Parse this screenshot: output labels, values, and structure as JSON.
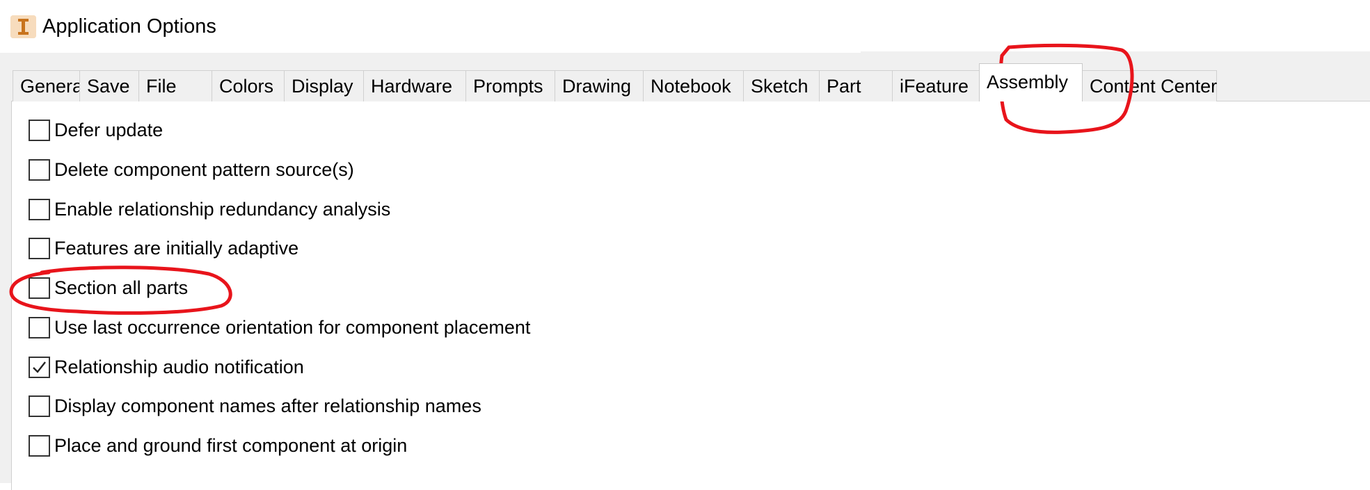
{
  "window": {
    "title": "Application Options",
    "icon": "autodesk-inventor-i-icon"
  },
  "tabs": [
    {
      "label": "General",
      "active": false
    },
    {
      "label": "Save",
      "active": false
    },
    {
      "label": "File",
      "active": false
    },
    {
      "label": "Colors",
      "active": false
    },
    {
      "label": "Display",
      "active": false
    },
    {
      "label": "Hardware",
      "active": false
    },
    {
      "label": "Prompts",
      "active": false
    },
    {
      "label": "Drawing",
      "active": false
    },
    {
      "label": "Notebook",
      "active": false
    },
    {
      "label": "Sketch",
      "active": false
    },
    {
      "label": "Part",
      "active": false
    },
    {
      "label": "iFeature",
      "active": false
    },
    {
      "label": "Assembly",
      "active": true
    },
    {
      "label": "Content Center",
      "active": false
    }
  ],
  "options": [
    {
      "label": "Defer update",
      "checked": false
    },
    {
      "label": "Delete component pattern source(s)",
      "checked": false
    },
    {
      "label": "Enable relationship redundancy analysis",
      "checked": false
    },
    {
      "label": "Features are initially adaptive",
      "checked": false
    },
    {
      "label": "Section all parts",
      "checked": false
    },
    {
      "label": "Use last occurrence orientation for component placement",
      "checked": false
    },
    {
      "label": "Relationship audio notification",
      "checked": true
    },
    {
      "label": "Display component names after relationship names",
      "checked": false
    },
    {
      "label": "Place and ground first component at origin",
      "checked": false
    }
  ],
  "annotations": {
    "color": "#e8141b",
    "circled": [
      "Assembly",
      "Section all parts"
    ]
  }
}
